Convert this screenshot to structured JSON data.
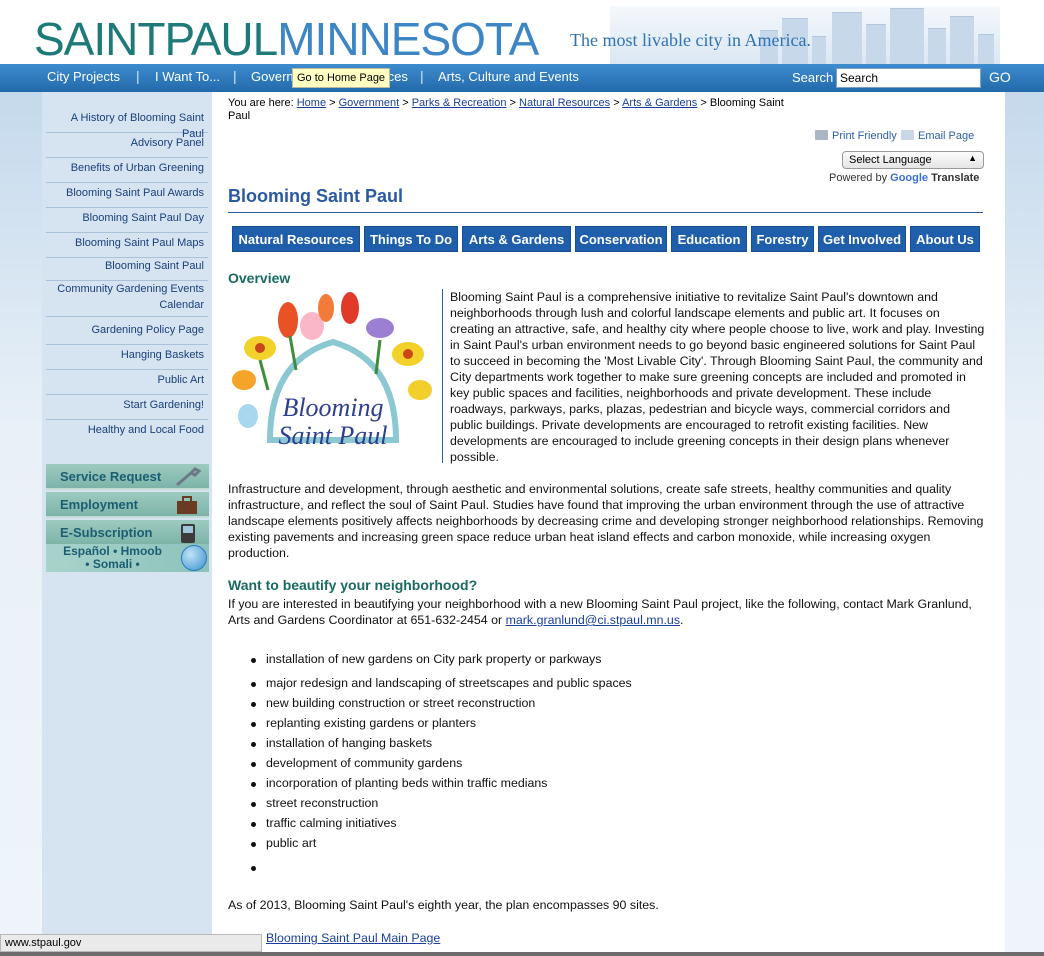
{
  "header": {
    "brand_part1": "SAINTPAUL",
    "brand_part2": "MINNESOTA",
    "tagline": "The most livable city in America."
  },
  "nav": {
    "items": [
      {
        "label": "City Projects"
      },
      {
        "label": "I Want To..."
      },
      {
        "label": "Government"
      },
      {
        "label": "Services"
      },
      {
        "label": "Arts, Culture and Events"
      }
    ],
    "separator": "|",
    "tooltip": "Go to Home Page",
    "search_label": "Search",
    "search_value": "Search",
    "go_label": "GO"
  },
  "sidebar": {
    "items": [
      {
        "label": "A History of Blooming Saint Paul"
      },
      {
        "label": "Advisory Panel"
      },
      {
        "label": "Benefits of Urban Greening"
      },
      {
        "label": "Blooming Saint Paul Awards"
      },
      {
        "label": "Blooming Saint Paul Day"
      },
      {
        "label": "Blooming Saint Paul Maps"
      },
      {
        "label": "Blooming Saint Paul"
      },
      {
        "label": "Community Gardening Events Calendar"
      },
      {
        "label": "Gardening Policy Page"
      },
      {
        "label": "Hanging Baskets"
      },
      {
        "label": "Public Art"
      },
      {
        "label": "Start Gardening!"
      },
      {
        "label": "Healthy and Local Food"
      }
    ],
    "buttons": [
      {
        "label": "Service Request"
      },
      {
        "label": "Employment"
      },
      {
        "label": "E-Subscription"
      }
    ],
    "language_line1": "Español • Hmoob",
    "language_line2": "• Somali •"
  },
  "breadcrumb": {
    "prefix": "You are here:",
    "links": [
      "Home",
      "Government",
      "Parks & Recreation",
      "Natural Resources",
      "Arts & Gardens"
    ],
    "separator": ">",
    "current": "Blooming Saint Paul"
  },
  "tools": {
    "print_label": "Print Friendly",
    "email_label": "Email Page",
    "language_select": "Select Language",
    "powered_by": "Powered by",
    "google": "Google",
    "translate": "Translate"
  },
  "page": {
    "title": "Blooming Saint Paul",
    "tabs": [
      {
        "label": "Natural Resources"
      },
      {
        "label": "Things To Do"
      },
      {
        "label": "Arts & Gardens"
      },
      {
        "label": "Conservation"
      },
      {
        "label": "Education"
      },
      {
        "label": "Forestry"
      },
      {
        "label": "Get Involved"
      },
      {
        "label": "About Us"
      }
    ],
    "overview_heading": "Overview",
    "logo_line1": "Blooming",
    "logo_line2": "Saint Paul",
    "intro": "Blooming Saint Paul is a comprehensive initiative to revitalize Saint Paul's downtown and neighborhoods through lush and colorful landscape elements and public art. It focuses on creating an attractive, safe, and healthy city where people choose to live, work and play. Investing in Saint Paul's urban environment needs to go beyond basic engineered solutions for Saint Paul to succeed in becoming the 'Most Livable City'. Through Blooming Saint Paul, the community and City departments work together to make sure greening concepts are included and promoted in key public spaces and facilities, neighborhoods and private development. These include roadways, parkways, parks, plazas, pedestrian and bicycle ways, commercial corridors and public buildings. Private developments are encouraged to retrofit existing facilities. New developments are encouraged to include greening concepts in their design plans whenever possible.",
    "infrastructure": "Infrastructure and development, through aesthetic and environmental solutions, create safe streets, healthy communities and quality infrastructure, and reflect the soul of Saint Paul. Studies have found that improving the urban environment through the use of attractive landscape elements positively affects neighborhoods by decreasing crime and developing stronger neighborhood relationships. Removing existing pavements and increasing green space reduce urban heat island effects and carbon monoxide, while increasing oxygen production.",
    "beautify_heading": "Want to beautify your neighborhood?",
    "beautify_text": "If you are interested in beautifying your neighborhood with a new Blooming Saint Paul project, like the following, contact Mark Granlund, Arts and Gardens Coordinator at 651-632-2454 or",
    "beautify_email": "mark.granlund@ci.stpaul.mn.us",
    "beautify_period": ".",
    "bullets": [
      "installation of new gardens on City park property or parkways",
      "major redesign and landscaping of streetscapes and public spaces",
      "new building construction or street reconstruction",
      "replanting existing gardens or planters",
      "installation of hanging baskets",
      "development of community gardens",
      "incorporation of planting beds within traffic medians",
      "street reconstruction",
      "traffic calming initiatives",
      "public art",
      ""
    ],
    "closing": "As of 2013, Blooming Saint Paul's eighth year, the plan encompasses 90 sites.",
    "main_link": "Blooming Saint Paul Main Page"
  },
  "status_bar": "www.stpaul.gov",
  "colors": {
    "brand_teal": "#1d7a78",
    "brand_blue": "#3d86c6",
    "nav_blue": "#2369aa",
    "tab_blue": "#1f5eaa",
    "heading_green": "#1a6a62"
  }
}
